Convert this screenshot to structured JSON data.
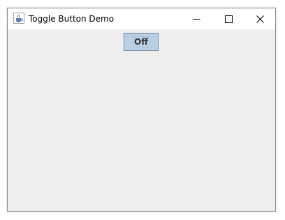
{
  "window": {
    "title": "Toggle Button Demo",
    "app_icon": "java-cup-icon",
    "controls": {
      "minimize": "minimize-icon",
      "maximize": "maximize-icon",
      "close": "close-icon"
    }
  },
  "content": {
    "toggle_button": {
      "label": "Off",
      "selected": false
    }
  },
  "colors": {
    "titlebar": "#ffffff",
    "content_background": "#eeeeee",
    "toggle_background": "#b8cfe5",
    "toggle_border": "#7a8a99",
    "toggle_text": "#333333"
  }
}
